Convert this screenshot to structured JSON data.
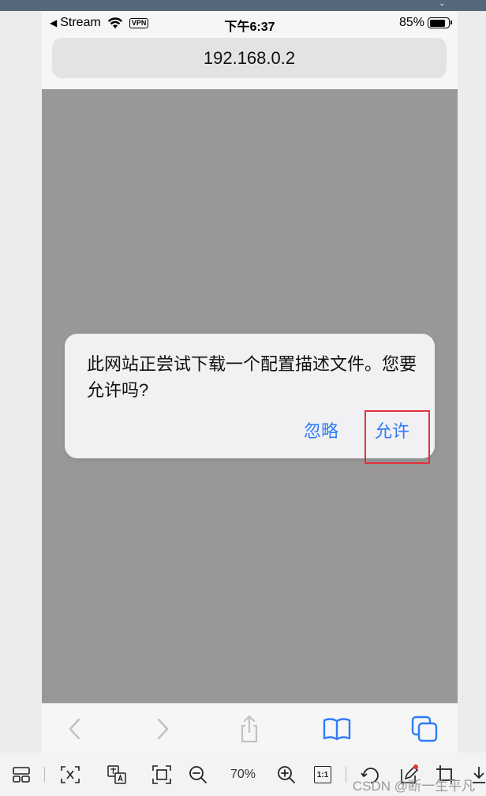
{
  "status_bar": {
    "back_app": "Stream",
    "vpn": "VPN",
    "time": "下午6:37",
    "battery_percent": "85%",
    "battery_level": 0.85
  },
  "url_bar": {
    "url": "192.168.0.2"
  },
  "dialog": {
    "message": "此网站正尝试下载一个配置描述文件。您要允许吗?",
    "ignore_label": "忽略",
    "allow_label": "允许"
  },
  "safari_toolbar": {
    "icons": [
      "back-icon",
      "forward-icon",
      "share-icon",
      "bookmarks-icon",
      "tabs-icon"
    ]
  },
  "viewer_toolbar": {
    "zoom_level": "70%",
    "actual_size_label": "1:1",
    "watermark": "CSDN @断一生平凡"
  },
  "colors": {
    "accent": "#2f7cf6",
    "highlight": "#e5313b",
    "overlay": "#989898"
  }
}
